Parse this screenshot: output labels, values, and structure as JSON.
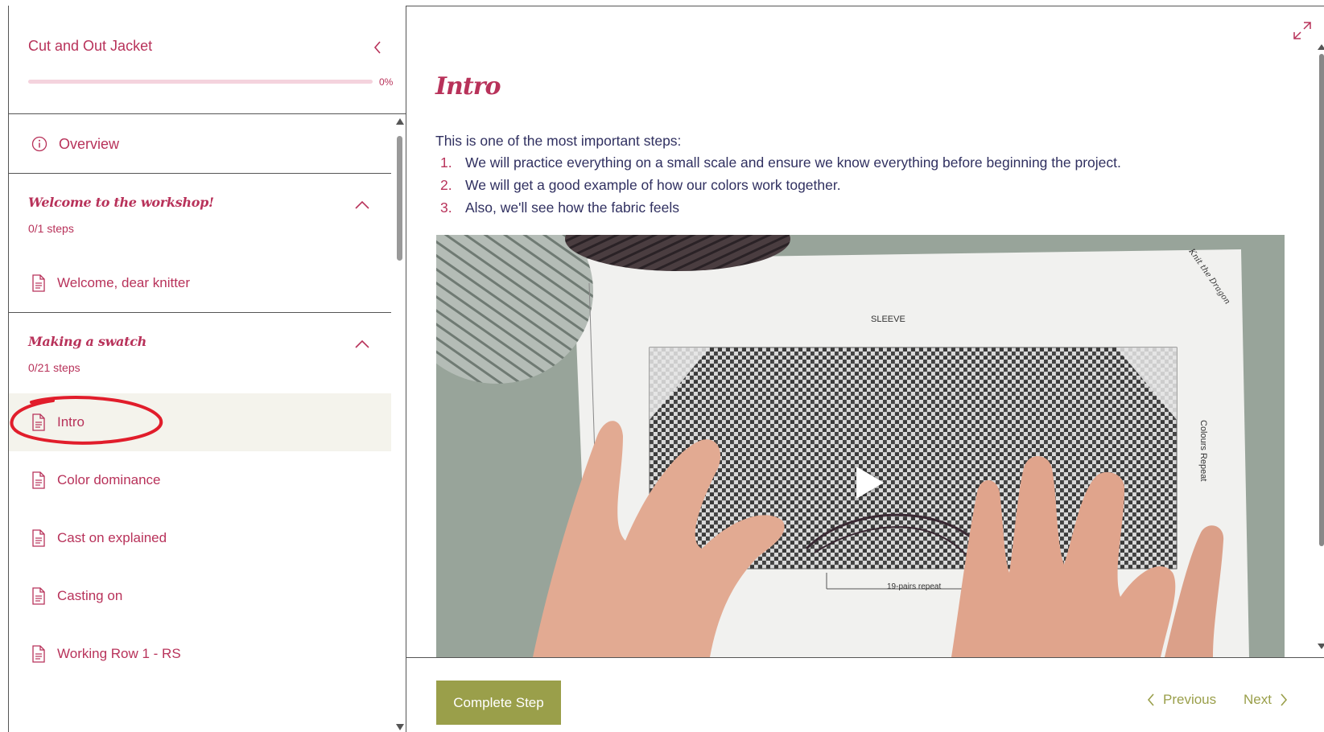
{
  "sidebar": {
    "course_title": "Cut and Out Jacket",
    "progress_percent": 0,
    "progress_label": "0%",
    "overview_label": "Overview",
    "sections": [
      {
        "title": "Welcome to the workshop!",
        "steps_label": "0/1 steps",
        "steps": [
          {
            "label": "Welcome, dear knitter",
            "active": false
          }
        ]
      },
      {
        "title": "Making a swatch",
        "steps_label": "0/21 steps",
        "steps": [
          {
            "label": "Intro",
            "active": true
          },
          {
            "label": "Color dominance",
            "active": false
          },
          {
            "label": "Cast on explained",
            "active": false
          },
          {
            "label": "Casting on",
            "active": false
          },
          {
            "label": "Working Row 1 - RS",
            "active": false
          }
        ]
      }
    ]
  },
  "main": {
    "step_title": "Intro",
    "intro_text": "This is one of the most important steps:",
    "points": [
      {
        "num": "1.",
        "text": "We will practice everything on a small scale and ensure we know everything before beginning the project."
      },
      {
        "num": "2.",
        "text": "We will get a good example of how our colors work together."
      },
      {
        "num": "3.",
        "text": "Also, we'll see how the fabric feels"
      }
    ],
    "video": {
      "chart_heading": "SLEEVE",
      "side_label": "Colours Repeat",
      "repeat_label": "19-pairs repeat",
      "sign_text": "Knit the Dragon"
    }
  },
  "footer": {
    "complete_label": "Complete Step",
    "previous_label": "Previous",
    "next_label": "Next"
  },
  "colors": {
    "accent": "#b8325a",
    "olive": "#9a9f4a",
    "active_row_bg": "#f4f3ec",
    "annotation_red": "#e11d2b"
  },
  "icons": {
    "collapse": "chevron-left-icon",
    "overview": "info-circle-icon",
    "step": "document-icon",
    "section_toggle": "chevron-up-icon",
    "expand": "expand-arrows-icon",
    "play": "play-icon"
  }
}
